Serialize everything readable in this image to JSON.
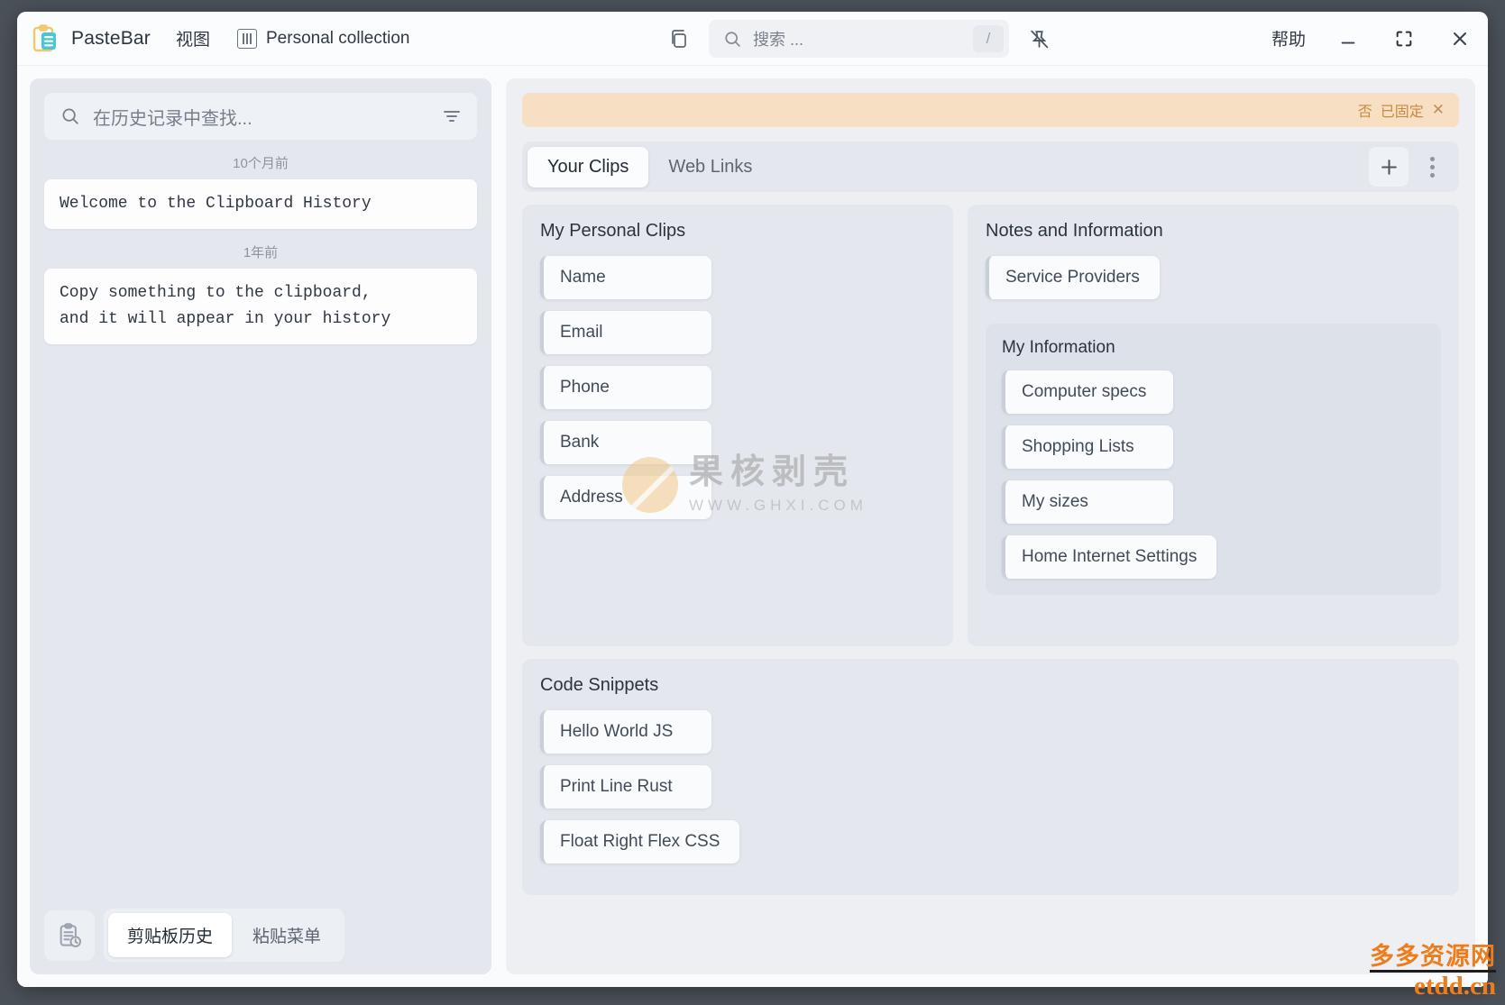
{
  "titlebar": {
    "brand": "PasteBar",
    "view_menu": "视图",
    "collection_label": "Personal collection",
    "search_placeholder": "搜索 ...",
    "search_shortcut": "/",
    "help_label": "帮助",
    "icons": {
      "logo": "clipboard-logo-icon",
      "collection": "collection-columns-icon",
      "split_view": "split-view-icon",
      "search": "search-icon",
      "unpin_all": "unpin-icon",
      "minimize": "minimize-icon",
      "maximize": "maximize-icon",
      "close": "close-icon"
    }
  },
  "sidebar": {
    "search_placeholder": "在历史记录中查找...",
    "filter_icon": "filter-icon",
    "groups": [
      {
        "day_label": "10个月前",
        "items": [
          {
            "text": "Welcome to the Clipboard History"
          }
        ]
      },
      {
        "day_label": "1年前",
        "items": [
          {
            "text": "Copy something to the clipboard,\nand it will appear in your history"
          }
        ]
      }
    ],
    "footer": {
      "history_icon": "clipboard-clock-icon",
      "tabs": [
        {
          "label": "剪贴板历史",
          "active": true
        },
        {
          "label": "粘贴菜单",
          "active": false
        }
      ]
    }
  },
  "main": {
    "pinned_bar": {
      "label_no": "否",
      "label_pinned": "已固定",
      "close_glyph": "✕"
    },
    "tabs": [
      {
        "label": "Your Clips",
        "active": true
      },
      {
        "label": "Web Links",
        "active": false
      }
    ],
    "tab_actions": {
      "add_glyph": "+",
      "add_icon": "plus-icon",
      "more_icon": "more-vertical-icon"
    },
    "boards": [
      {
        "id": "board-personal",
        "title": "My Personal Clips",
        "clips": [
          {
            "label": "Name"
          },
          {
            "label": "Email"
          },
          {
            "label": "Phone"
          },
          {
            "label": "Bank"
          },
          {
            "label": "Address"
          }
        ]
      },
      {
        "id": "board-notes",
        "title": "Notes and Information",
        "clips": [
          {
            "label": "Service Providers"
          }
        ],
        "subboard": {
          "title": "My Information",
          "clips": [
            {
              "label": "Computer specs"
            },
            {
              "label": "Shopping Lists"
            },
            {
              "label": "My sizes"
            },
            {
              "label": "Home Internet Settings"
            }
          ]
        }
      },
      {
        "id": "board-code",
        "title": "Code Snippets",
        "clips": [
          {
            "label": "Hello World JS"
          },
          {
            "label": "Print Line Rust"
          },
          {
            "label": "Float Right Flex CSS"
          }
        ]
      }
    ]
  },
  "watermarks": {
    "center_text": "果核剥壳",
    "center_url": "WWW.GHXI.COM",
    "brand_top": "多多资源网",
    "brand_bottom": "etdd.cn"
  },
  "colors": {
    "desktop": "#4b5159",
    "window": "#fafbfc",
    "sidebar": "#e4e8ee",
    "panel": "#edeff3",
    "board": "#e4e8ee",
    "pinned": "#f7dfc4",
    "pinned_text": "#c88a3e",
    "accent_logo": "#4cc5d8",
    "watermark_orange": "#ef7c1a"
  }
}
